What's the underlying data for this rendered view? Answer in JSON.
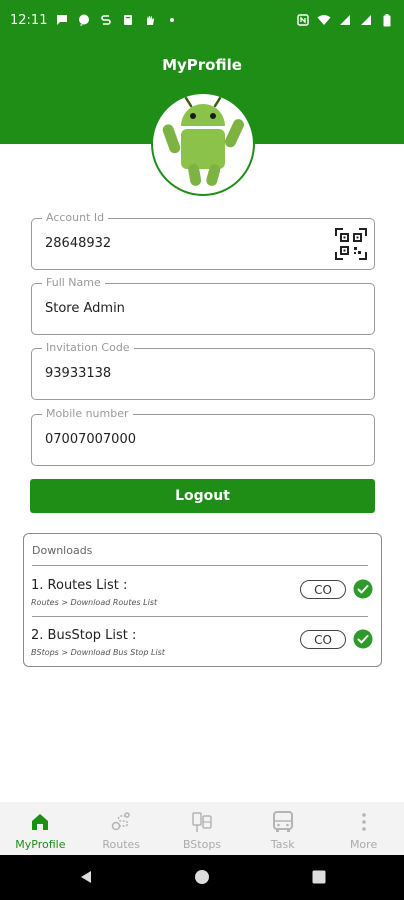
{
  "status_bar": {
    "time": "12:11",
    "left_icons": [
      "message-icon",
      "chat-bubble-icon",
      "s-icon",
      "document-icon",
      "hand-icon",
      "dot-icon"
    ],
    "right_icons": [
      "nfc-icon",
      "wifi-icon",
      "signal-icon",
      "signal-icon",
      "battery-icon"
    ]
  },
  "header": {
    "title": "MyProfile"
  },
  "avatar": {
    "icon": "android-icon"
  },
  "fields": {
    "account_id": {
      "label": "Account Id",
      "value": "28648932"
    },
    "full_name": {
      "label": "Full Name",
      "value": "Store Admin"
    },
    "invitation_code": {
      "label": "Invitation Code",
      "value": "93933138"
    },
    "mobile_number": {
      "label": "Mobile number",
      "value": "07007007000"
    }
  },
  "logout_label": "Logout",
  "downloads": {
    "title": "Downloads",
    "items": [
      {
        "name": "1. Routes List :",
        "sub": "Routes > Download Routes List",
        "button": "CO",
        "status": "check-circle-icon"
      },
      {
        "name": "2. BusStop List :",
        "sub": "BStops > Download Bus Stop List",
        "button": "CO",
        "status": "check-circle-icon"
      }
    ]
  },
  "bottom_nav": [
    {
      "label": "MyProfile",
      "icon": "home-icon",
      "active": true
    },
    {
      "label": "Routes",
      "icon": "route-icon",
      "active": false
    },
    {
      "label": "BStops",
      "icon": "bus-stop-icon",
      "active": false
    },
    {
      "label": "Task",
      "icon": "bus-icon",
      "active": false
    },
    {
      "label": "More",
      "icon": "more-vertical-icon",
      "active": false
    }
  ],
  "colors": {
    "primary": "#1f8e17",
    "check": "#2e9a2a",
    "inactive_nav": "#aaaaaa"
  }
}
